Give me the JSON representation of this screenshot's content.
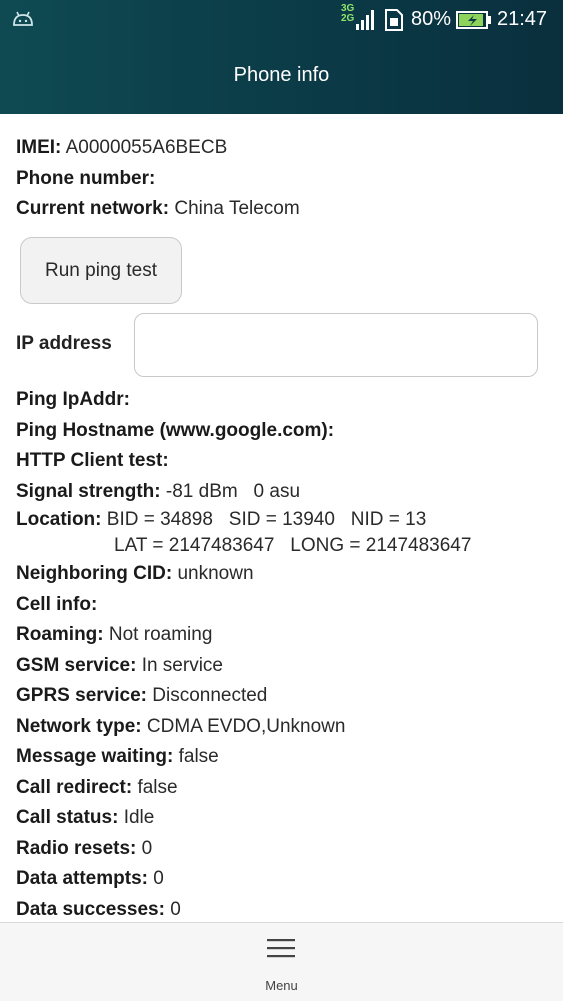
{
  "status_bar": {
    "net_top": "3G",
    "net_bottom": "2G",
    "battery_percent": "80%",
    "time": "21:47"
  },
  "header": {
    "title": "Phone info"
  },
  "info_top": [
    {
      "label": "IMEI:",
      "value": "A0000055A6BECB"
    },
    {
      "label": "Phone number:",
      "value": ""
    },
    {
      "label": "Current network:",
      "value": "China Telecom"
    }
  ],
  "ping_button_label": "Run ping test",
  "ip_address": {
    "label": "IP address",
    "value": ""
  },
  "info_rows": [
    {
      "label": "Ping IpAddr:",
      "value": ""
    },
    {
      "label": "Ping Hostname (www.google.com):",
      "value": ""
    },
    {
      "label": "HTTP Client test:",
      "value": ""
    },
    {
      "label": "Signal strength:",
      "value": "-81 dBm   0 asu"
    },
    {
      "label": "Location:",
      "value": "BID = 34898   SID = 13940   NID = 13"
    }
  ],
  "location_line2": "LAT = 2147483647   LONG = 2147483647",
  "info_rows2": [
    {
      "label": "Neighboring CID:",
      "value": "unknown"
    },
    {
      "label": "Cell info:",
      "value": ""
    },
    {
      "label": "Roaming:",
      "value": "Not roaming"
    },
    {
      "label": "GSM service:",
      "value": "In service"
    },
    {
      "label": "GPRS service:",
      "value": "Disconnected"
    },
    {
      "label": "Network type:",
      "value": "CDMA EVDO,Unknown"
    },
    {
      "label": "Message waiting:",
      "value": "false"
    },
    {
      "label": "Call redirect:",
      "value": "false"
    },
    {
      "label": "Call status:",
      "value": "Idle"
    },
    {
      "label": "Radio resets:",
      "value": "0"
    },
    {
      "label": "Data attempts:",
      "value": "0"
    },
    {
      "label": "Data successes:",
      "value": "0"
    }
  ],
  "bottom_bar": {
    "menu_label": "Menu"
  },
  "colors": {
    "header": "#0b3c48",
    "net_badge": "#8fe36b",
    "battery_fill": "#8fd35a"
  }
}
